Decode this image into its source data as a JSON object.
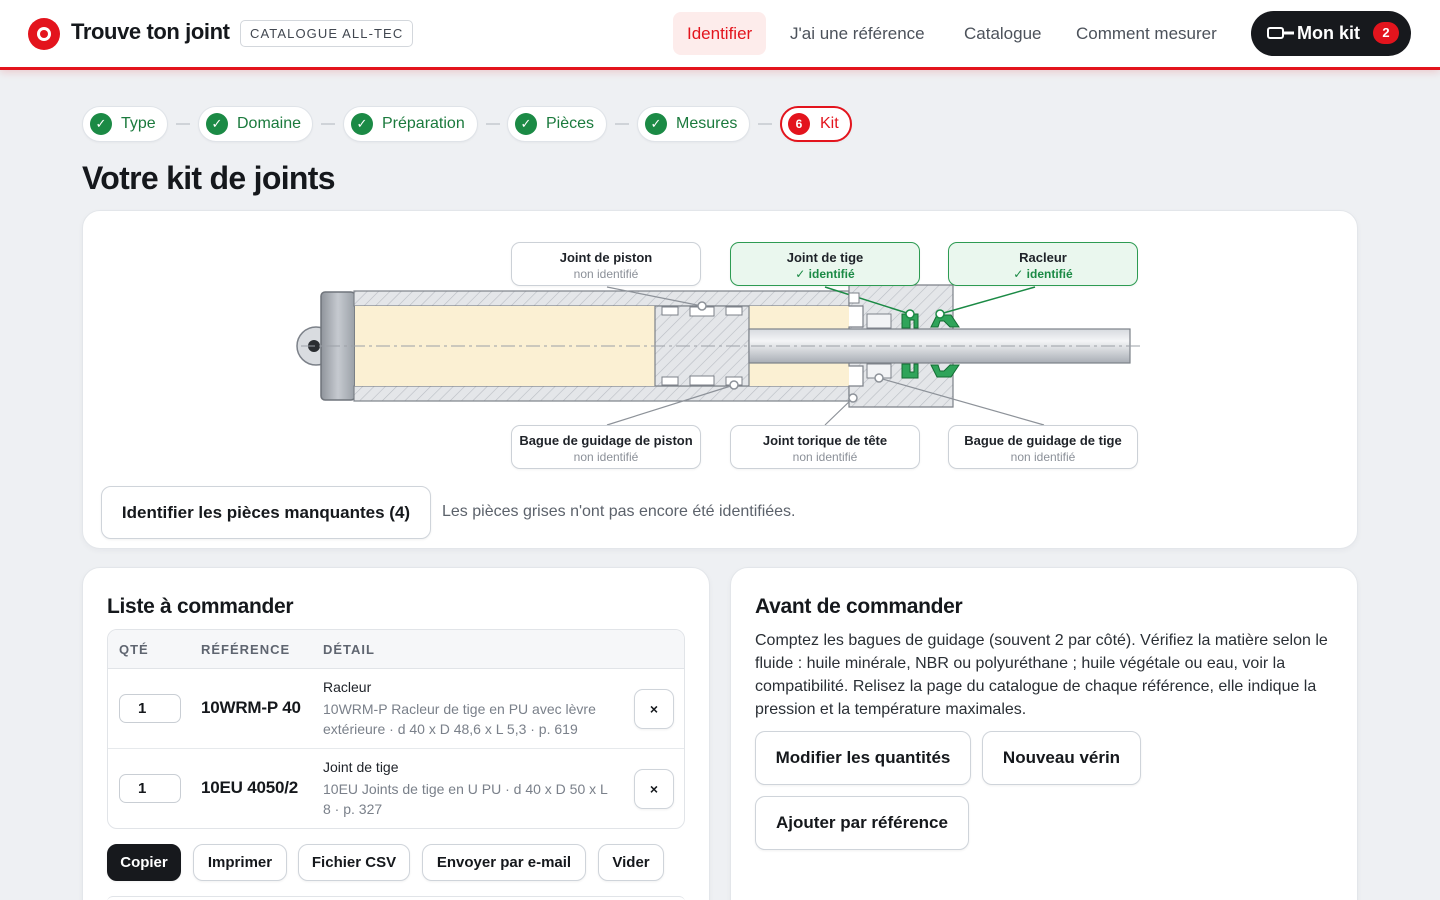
{
  "header": {
    "brand": "Trouve ton joint",
    "tag": "CATALOGUE ALL-TEC",
    "nav": [
      {
        "label": "Identifier",
        "active": true
      },
      {
        "label": "J'ai une référence",
        "active": false
      },
      {
        "label": "Catalogue",
        "active": false
      },
      {
        "label": "Comment mesurer",
        "active": false
      }
    ],
    "kit_label": "Mon kit",
    "kit_count": "2"
  },
  "steps": [
    {
      "label": "Type",
      "mark": "✓"
    },
    {
      "label": "Domaine",
      "mark": "✓"
    },
    {
      "label": "Préparation",
      "mark": "✓"
    },
    {
      "label": "Pièces",
      "mark": "✓"
    },
    {
      "label": "Mesures",
      "mark": "✓"
    },
    {
      "label": "Kit",
      "mark": "6"
    }
  ],
  "page_title": "Votre kit de joints",
  "diagram": {
    "labels": [
      {
        "name": "Joint de piston",
        "state": "non identifié"
      },
      {
        "name": "Joint de tige",
        "state": "✓ identifié"
      },
      {
        "name": "Racleur",
        "state": "✓ identifié"
      },
      {
        "name": "Bague de guidage de piston",
        "state": "non identifié"
      },
      {
        "name": "Joint torique de tête",
        "state": "non identifié"
      },
      {
        "name": "Bague de guidage de tige",
        "state": "non identifié"
      }
    ],
    "identify_button": "Identifier les pièces manquantes (4)",
    "hint": "Les pièces grises n'ont pas encore été identifiées."
  },
  "order_list": {
    "title": "Liste à commander",
    "columns": [
      "QTÉ",
      "RÉFÉRENCE",
      "DÉTAIL"
    ],
    "rows": [
      {
        "qty": "1",
        "ref": "10WRM-P 40",
        "type": "Racleur",
        "detail": "10WRM-P Racleur de tige en PU avec lèvre extérieure · d 40 x D 48,6 x L 5,3 · p. 619"
      },
      {
        "qty": "1",
        "ref": "10EU 4050/2",
        "type": "Joint de tige",
        "detail": "10EU Joints de tige en U PU · d 40 x D 50 x L 8 · p. 327"
      }
    ],
    "remove_label": "×",
    "actions": [
      "Copier",
      "Imprimer",
      "Fichier CSV",
      "Envoyer par e-mail",
      "Vider"
    ]
  },
  "advice": {
    "title": "Avant de commander",
    "text": "Comptez les bagues de guidage (souvent 2 par côté). Vérifiez la matière selon le fluide : huile minérale, NBR ou polyuréthane ; huile végétale ou eau, voir la compatibilité. Relisez la page du catalogue de chaque référence, elle indique la pression et la température maximales.",
    "buttons": [
      "Modifier les quantités",
      "Nouveau vérin",
      "Ajouter par référence"
    ]
  },
  "colors": {
    "accent": "#e3141d",
    "success": "#1b8a45",
    "dark": "#17191d"
  }
}
